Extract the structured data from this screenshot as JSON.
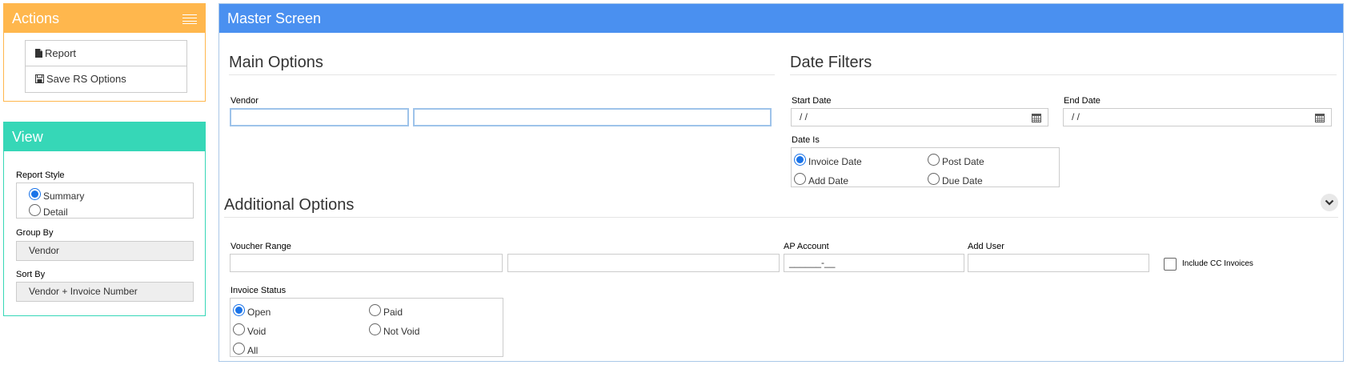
{
  "actions": {
    "title": "Actions",
    "items": [
      {
        "label": "Report",
        "icon": "file-icon"
      },
      {
        "label": "Save RS Options",
        "icon": "save-icon"
      }
    ]
  },
  "view": {
    "title": "View",
    "report_style": {
      "label": "Report Style",
      "options": [
        "Summary",
        "Detail"
      ],
      "selected": "Summary"
    },
    "group_by": {
      "label": "Group By",
      "value": "Vendor"
    },
    "sort_by": {
      "label": "Sort By",
      "value": "Vendor + Invoice Number"
    }
  },
  "master": {
    "title": "Master Screen",
    "main_options": {
      "title": "Main Options",
      "vendor_label": "Vendor",
      "vendor_code": "",
      "vendor_name": ""
    },
    "date_filters": {
      "title": "Date Filters",
      "start_label": "Start Date",
      "start_value": " /  /",
      "end_label": "End Date",
      "end_value": " /  /",
      "date_is_label": "Date Is",
      "options": [
        "Invoice Date",
        "Post Date",
        "Add Date",
        "Due Date"
      ],
      "selected": "Invoice Date"
    },
    "additional_options": {
      "title": "Additional Options",
      "voucher_label": "Voucher Range",
      "voucher_from": "",
      "voucher_to": "",
      "ap_account_label": "AP Account",
      "ap_account_value": "______-__",
      "add_user_label": "Add User",
      "add_user_value": "",
      "include_cc_label": "Include CC Invoices",
      "include_cc_checked": false,
      "invoice_status_label": "Invoice Status",
      "status_options": [
        "Open",
        "Paid",
        "Void",
        "Not Void",
        "All"
      ],
      "status_selected": "Open"
    }
  },
  "colors": {
    "actions": "#ffb74d",
    "view": "#36d7b7",
    "master": "#4a90f0",
    "radio_selected": "#1a73e8"
  }
}
